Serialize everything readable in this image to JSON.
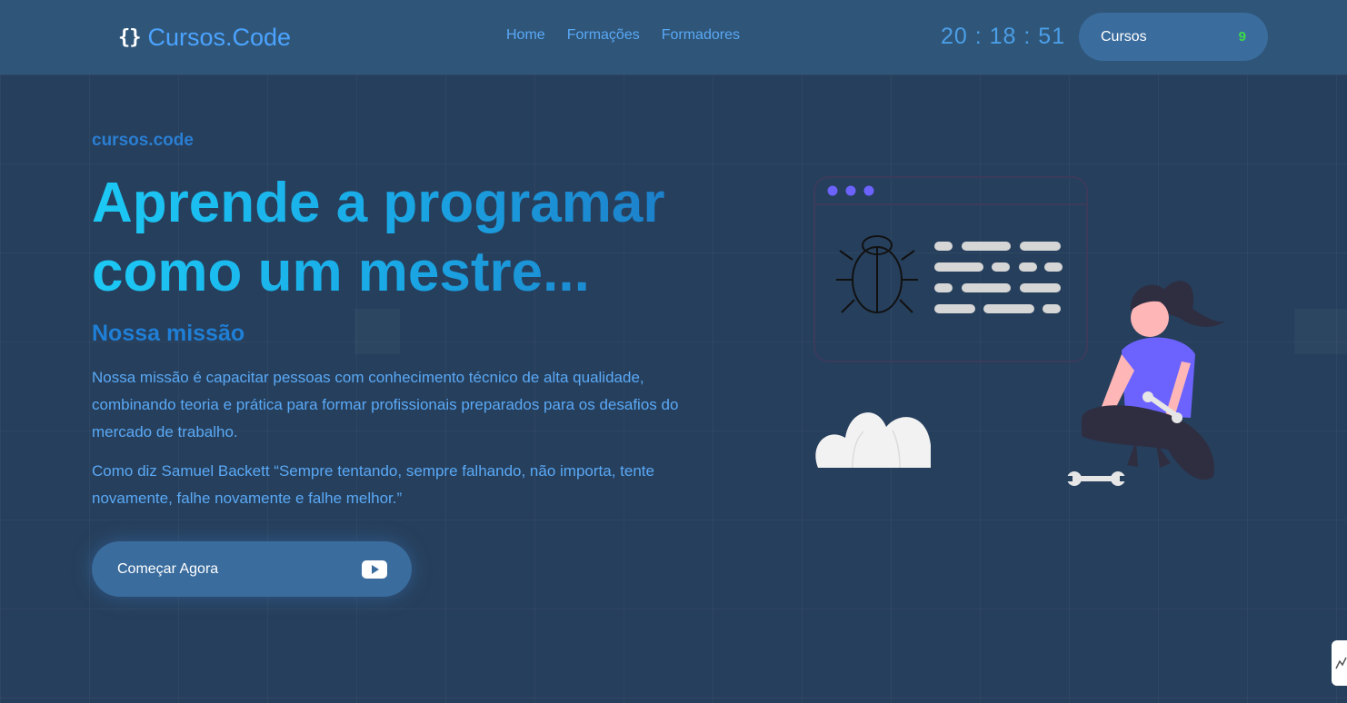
{
  "header": {
    "logo_braces": "{}",
    "logo_text": "Cursos.Code",
    "nav": [
      "Home",
      "Formações",
      "Formadores"
    ],
    "clock": "20 : 18 : 51",
    "cart": {
      "label": "Cursos",
      "count": "9"
    }
  },
  "hero": {
    "eyebrow": "cursos.code",
    "title_line1": "Aprende a programar",
    "title_line2": "como um mestre...",
    "section_title": "Nossa missão",
    "paragraph1": "Nossa missão é capacitar pessoas com conhecimento técnico de alta qualidade, combinando teoria e prática para formar profissionais preparados para os desafios do mercado de trabalho.",
    "paragraph2": "Como diz Samuel Backett “Sempre tentando, sempre falhando, não importa, tente novamente, falhe novamente e falhe melhor.”",
    "cta_label": "Começar Agora"
  },
  "colors": {
    "background": "#263f5c",
    "header": "#2f5679",
    "accent": "#4ba3ff",
    "button": "#3a6c9e",
    "count": "#3ddc4a",
    "illustration_purple": "#6c63ff"
  },
  "icons": {
    "logo": "braces-icon",
    "cta": "youtube-play-icon",
    "illustration": "debugging-developer-illustration"
  }
}
